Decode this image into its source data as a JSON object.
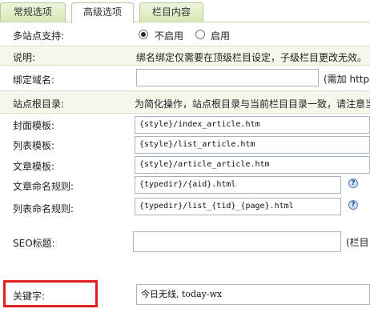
{
  "tabs": [
    {
      "label": "常规选项",
      "active": false
    },
    {
      "label": "高级选项",
      "active": true
    },
    {
      "label": "栏目内容",
      "active": false
    }
  ],
  "multisite": {
    "label": "多站点支持:",
    "options": [
      {
        "label": "不启用",
        "checked": true
      },
      {
        "label": "启用",
        "checked": false
      }
    ]
  },
  "note": {
    "label": "说明:",
    "text": "绑名绑定仅需要在顶级栏目设定，子级栏目更改无效。"
  },
  "domain": {
    "label": "绑定域名:",
    "value": "",
    "hint": "(需加 http"
  },
  "siteroot": {
    "label": "站点根目录:",
    "text": "为简化操作，站点根目录与当前栏目目录一致，请注意当"
  },
  "cover_template": {
    "label": "封面模板:",
    "value": "{style}/index_article.htm"
  },
  "list_template": {
    "label": "列表模板:",
    "value": "{style}/list_article.htm"
  },
  "article_template": {
    "label": "文章模板:",
    "value": "{style}/article_article.htm"
  },
  "article_naming": {
    "label": "文章命名规则:",
    "value": "{typedir}/{aid}.html"
  },
  "list_naming": {
    "label": "列表命名规则:",
    "value": "{typedir}/list_{tid}_{page}.html"
  },
  "seo_title": {
    "label": "SEO标题:",
    "value": "",
    "hint": "(栏目"
  },
  "keywords": {
    "label": "关键字:",
    "value": "今日无线, today-wx"
  },
  "help_icon": "?",
  "colors": {
    "row_shade": "#f3f8ea",
    "tab_gradient": "#d6e8b4",
    "highlight_box": "#e02020"
  }
}
